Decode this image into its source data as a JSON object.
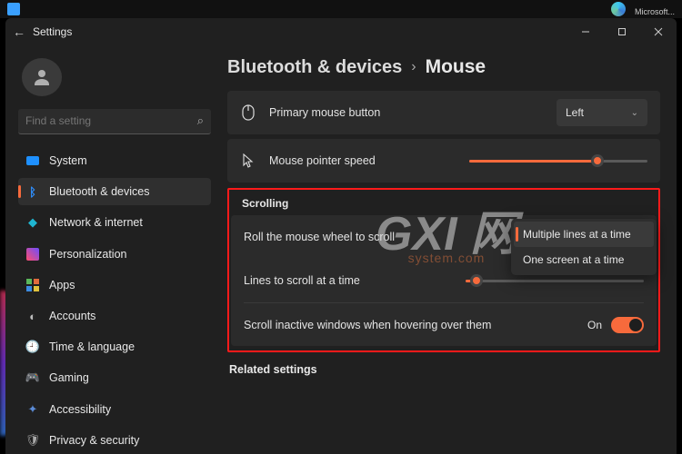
{
  "taskbar": {
    "edge_label": "Microsoft..."
  },
  "window": {
    "title": "Settings",
    "breadcrumb": {
      "parent": "Bluetooth & devices",
      "current": "Mouse"
    }
  },
  "sidebar": {
    "search_placeholder": "Find a setting",
    "items": [
      {
        "label": "System"
      },
      {
        "label": "Bluetooth & devices"
      },
      {
        "label": "Network & internet"
      },
      {
        "label": "Personalization"
      },
      {
        "label": "Apps"
      },
      {
        "label": "Accounts"
      },
      {
        "label": "Time & language"
      },
      {
        "label": "Gaming"
      },
      {
        "label": "Accessibility"
      },
      {
        "label": "Privacy & security"
      }
    ]
  },
  "main": {
    "primary_button": {
      "label": "Primary mouse button",
      "value": "Left"
    },
    "pointer_speed": {
      "label": "Mouse pointer speed",
      "value_pct": 72
    },
    "scrolling": {
      "header": "Scrolling",
      "roll_label": "Roll the mouse wheel to scroll",
      "roll_options": [
        "Multiple lines at a time",
        "One screen at a time"
      ],
      "roll_selected": 0,
      "lines_label": "Lines to scroll at a time",
      "lines_value_pct": 6,
      "inactive_label": "Scroll inactive windows when hovering over them",
      "inactive_state": "On"
    },
    "related_header": "Related settings"
  },
  "watermark": {
    "big": "GXI 网",
    "small": "system.com"
  }
}
